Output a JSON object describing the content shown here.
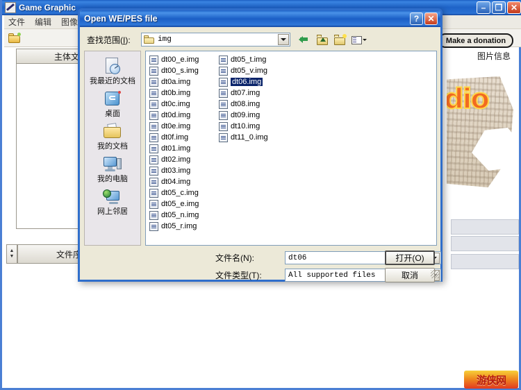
{
  "app": {
    "title": "Game Graphic",
    "icon": "pencil-icon",
    "menus": [
      "文件",
      "编辑",
      "图像"
    ],
    "toolbar": {
      "open_icon": "open-folder-icon"
    },
    "donate_label": "Make a donation",
    "tab_main_label": "主体文件",
    "column_header_file_no": "文件序号",
    "right_panel_label": "图片信息",
    "preview_word": "dio",
    "window_buttons": {
      "minimize": "–",
      "maximize": "❐",
      "close": "✕"
    }
  },
  "dialog": {
    "title": "Open WE/PES file",
    "title_buttons": {
      "help": "?",
      "close": "✕"
    },
    "lookin": {
      "label_prefix": "查找范围(",
      "label_key": "I",
      "label_suffix": "):",
      "value": "img",
      "folder_icon": "folder-icon"
    },
    "nav": [
      {
        "name": "back-icon",
        "label": "后退"
      },
      {
        "name": "up-one-level-icon",
        "label": "向上一级"
      },
      {
        "name": "new-folder-icon",
        "label": "新建文件夹"
      },
      {
        "name": "views-icon",
        "label": "查看"
      }
    ],
    "places": [
      {
        "icon": "recent-documents-icon",
        "label": "我最近的文档"
      },
      {
        "icon": "desktop-icon",
        "label": "桌面"
      },
      {
        "icon": "my-documents-icon",
        "label": "我的文档"
      },
      {
        "icon": "my-computer-icon",
        "label": "我的电脑"
      },
      {
        "icon": "network-places-icon",
        "label": "网上邻居"
      }
    ],
    "files": [
      {
        "name": "dt00_e.img",
        "selected": false
      },
      {
        "name": "dt00_s.img",
        "selected": false
      },
      {
        "name": "dt0a.img",
        "selected": false
      },
      {
        "name": "dt0b.img",
        "selected": false
      },
      {
        "name": "dt0c.img",
        "selected": false
      },
      {
        "name": "dt0d.img",
        "selected": false
      },
      {
        "name": "dt0e.img",
        "selected": false
      },
      {
        "name": "dt0f.img",
        "selected": false
      },
      {
        "name": "dt01.img",
        "selected": false
      },
      {
        "name": "dt02.img",
        "selected": false
      },
      {
        "name": "dt03.img",
        "selected": false
      },
      {
        "name": "dt04.img",
        "selected": false
      },
      {
        "name": "dt05_c.img",
        "selected": false
      },
      {
        "name": "dt05_e.img",
        "selected": false
      },
      {
        "name": "dt05_n.img",
        "selected": false
      },
      {
        "name": "dt05_r.img",
        "selected": false
      },
      {
        "name": "dt05_t.img",
        "selected": false
      },
      {
        "name": "dt05_v.img",
        "selected": false
      },
      {
        "name": "dt06.img",
        "selected": true
      },
      {
        "name": "dt07.img",
        "selected": false
      },
      {
        "name": "dt08.img",
        "selected": false
      },
      {
        "name": "dt09.img",
        "selected": false
      },
      {
        "name": "dt10.img",
        "selected": false
      },
      {
        "name": "dt11_0.img",
        "selected": false
      }
    ],
    "filename": {
      "label": "文件名(N):",
      "value": "dt06"
    },
    "filetype": {
      "label": "文件类型(T):",
      "value": "All supported files"
    },
    "open_button": "打开(O)",
    "cancel_button": "取消"
  },
  "watermark": {
    "text": "游侠网"
  },
  "colors": {
    "titlebar_blue": "#1e63c8",
    "dialog_face": "#ece9d8",
    "selection_blue": "#0a246a",
    "places_bar": "#e9e6ea",
    "accent_orange": "#f26a21"
  }
}
